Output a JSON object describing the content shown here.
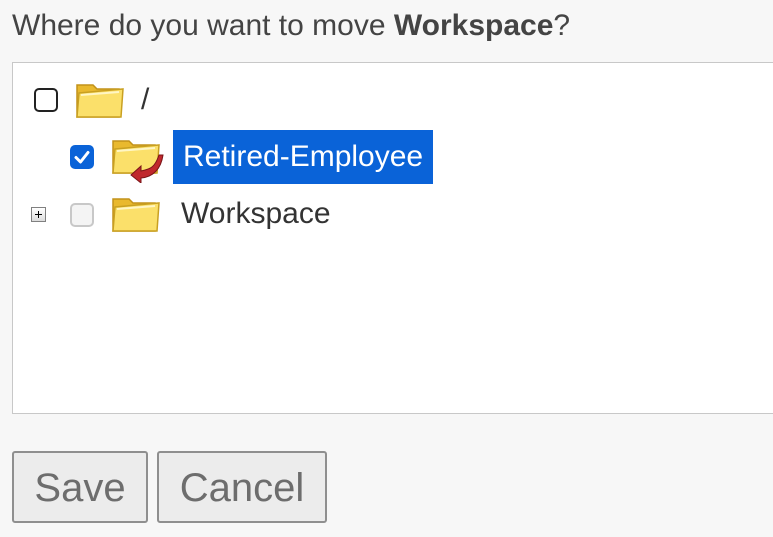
{
  "prompt": {
    "prefix": "Where do you want to move ",
    "item": "Workspace",
    "suffix": "?"
  },
  "tree": {
    "nodes": [
      {
        "label": "/",
        "checked": false,
        "selected": false,
        "icon": "folder-open-icon"
      },
      {
        "label": "Retired-Employee",
        "checked": true,
        "selected": true,
        "icon": "folder-move-target-icon"
      },
      {
        "label": "Workspace",
        "checked": false,
        "disabled": true,
        "selected": false,
        "expandable": true,
        "icon": "folder-icon"
      }
    ]
  },
  "buttons": {
    "save": "Save",
    "cancel": "Cancel"
  },
  "colors": {
    "accent": "#0a63d8",
    "folder": "#f5d54c"
  }
}
